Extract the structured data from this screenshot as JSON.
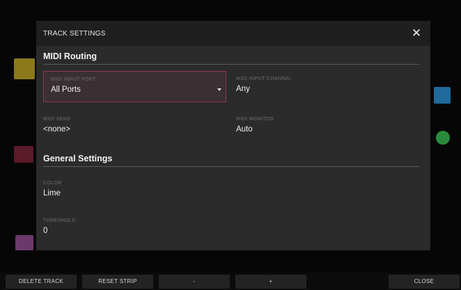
{
  "dialog": {
    "title": "TRACK SETTINGS",
    "close_glyph": "✕"
  },
  "midi_routing": {
    "title": "MIDI Routing",
    "input_port": {
      "label": "MIDI INPUT PORT",
      "value": "All Ports"
    },
    "input_channel": {
      "label": "MIDI INPUT CHANNEL",
      "value": "Any"
    },
    "send": {
      "label": "MIDI SEND",
      "value": "<none>"
    },
    "monitor": {
      "label": "MIDI MONITOR",
      "value": "Auto"
    }
  },
  "general_settings": {
    "title": "General Settings",
    "color": {
      "label": "COLOR",
      "value": "Lime"
    },
    "threshold": {
      "label": "THRESHOLD",
      "value": "0"
    }
  },
  "toolbar": {
    "delete_track": "DELETE TRACK",
    "reset_strip": "RESET STRIP",
    "minus": "-",
    "plus": "+",
    "close": "CLOSE"
  },
  "colors": {
    "accent_focus": "#8c3a4a",
    "background": "#060606",
    "dialog": "#2b2b2b"
  }
}
